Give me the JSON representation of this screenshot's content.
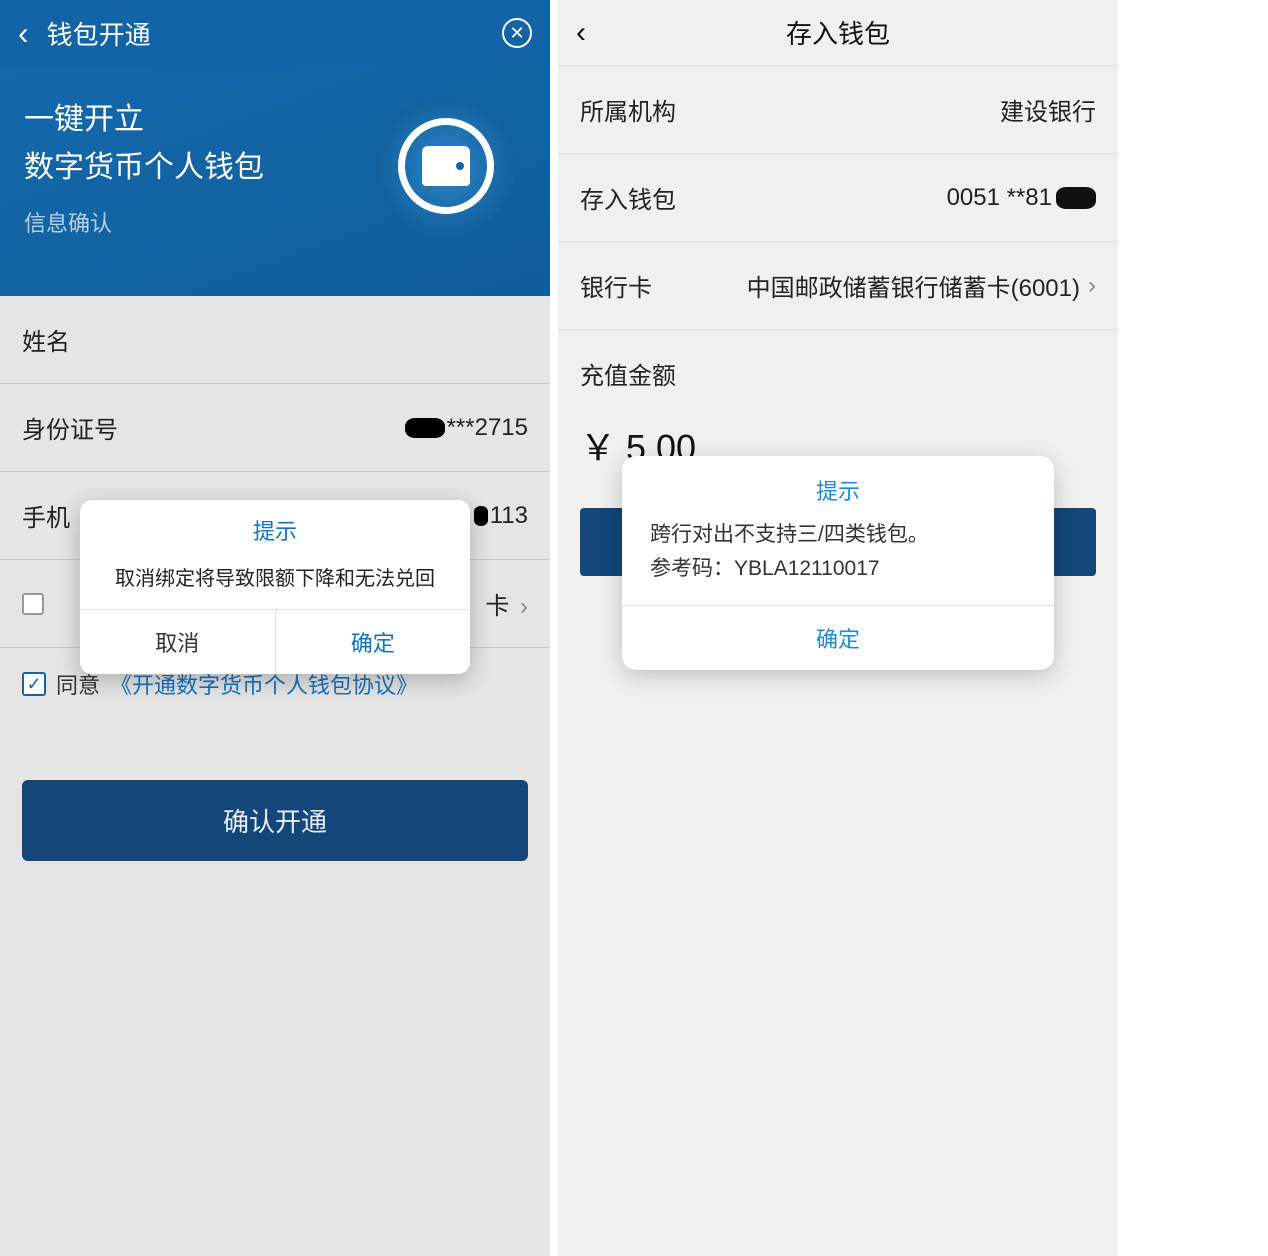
{
  "left": {
    "header_title": "钱包开通",
    "hero_line1": "一键开立",
    "hero_line2": "数字货币个人钱包",
    "hero_sub": "信息确认",
    "fields": {
      "name_label": "姓名",
      "id_label": "身份证号",
      "id_value_frag1": "***2715",
      "phone_label": "手机",
      "phone_value_frag": "113",
      "card_suffix": "卡"
    },
    "agree_label": "同意",
    "agreement_link": "《开通数字货币个人钱包协议》",
    "confirm_button": "确认开通",
    "dialog": {
      "title": "提示",
      "body": "取消绑定将导致限额下降和无法兑回",
      "cancel": "取消",
      "ok": "确定"
    }
  },
  "right": {
    "header_title": "存入钱包",
    "rows": {
      "institution_label": "所属机构",
      "institution_value": "建设银行",
      "wallet_label": "存入钱包",
      "wallet_value": "0051 **81",
      "bankcard_label": "银行卡",
      "bankcard_value": "中国邮政储蓄银行储蓄卡(6001)"
    },
    "amount_label": "充值金额",
    "amount_value": "￥ 5.00",
    "dialog": {
      "title": "提示",
      "body_line1": "跨行对出不支持三/四类钱包。",
      "body_line2_label": "参考码：",
      "body_line2_value": "YBLA12110017",
      "ok": "确定"
    }
  }
}
